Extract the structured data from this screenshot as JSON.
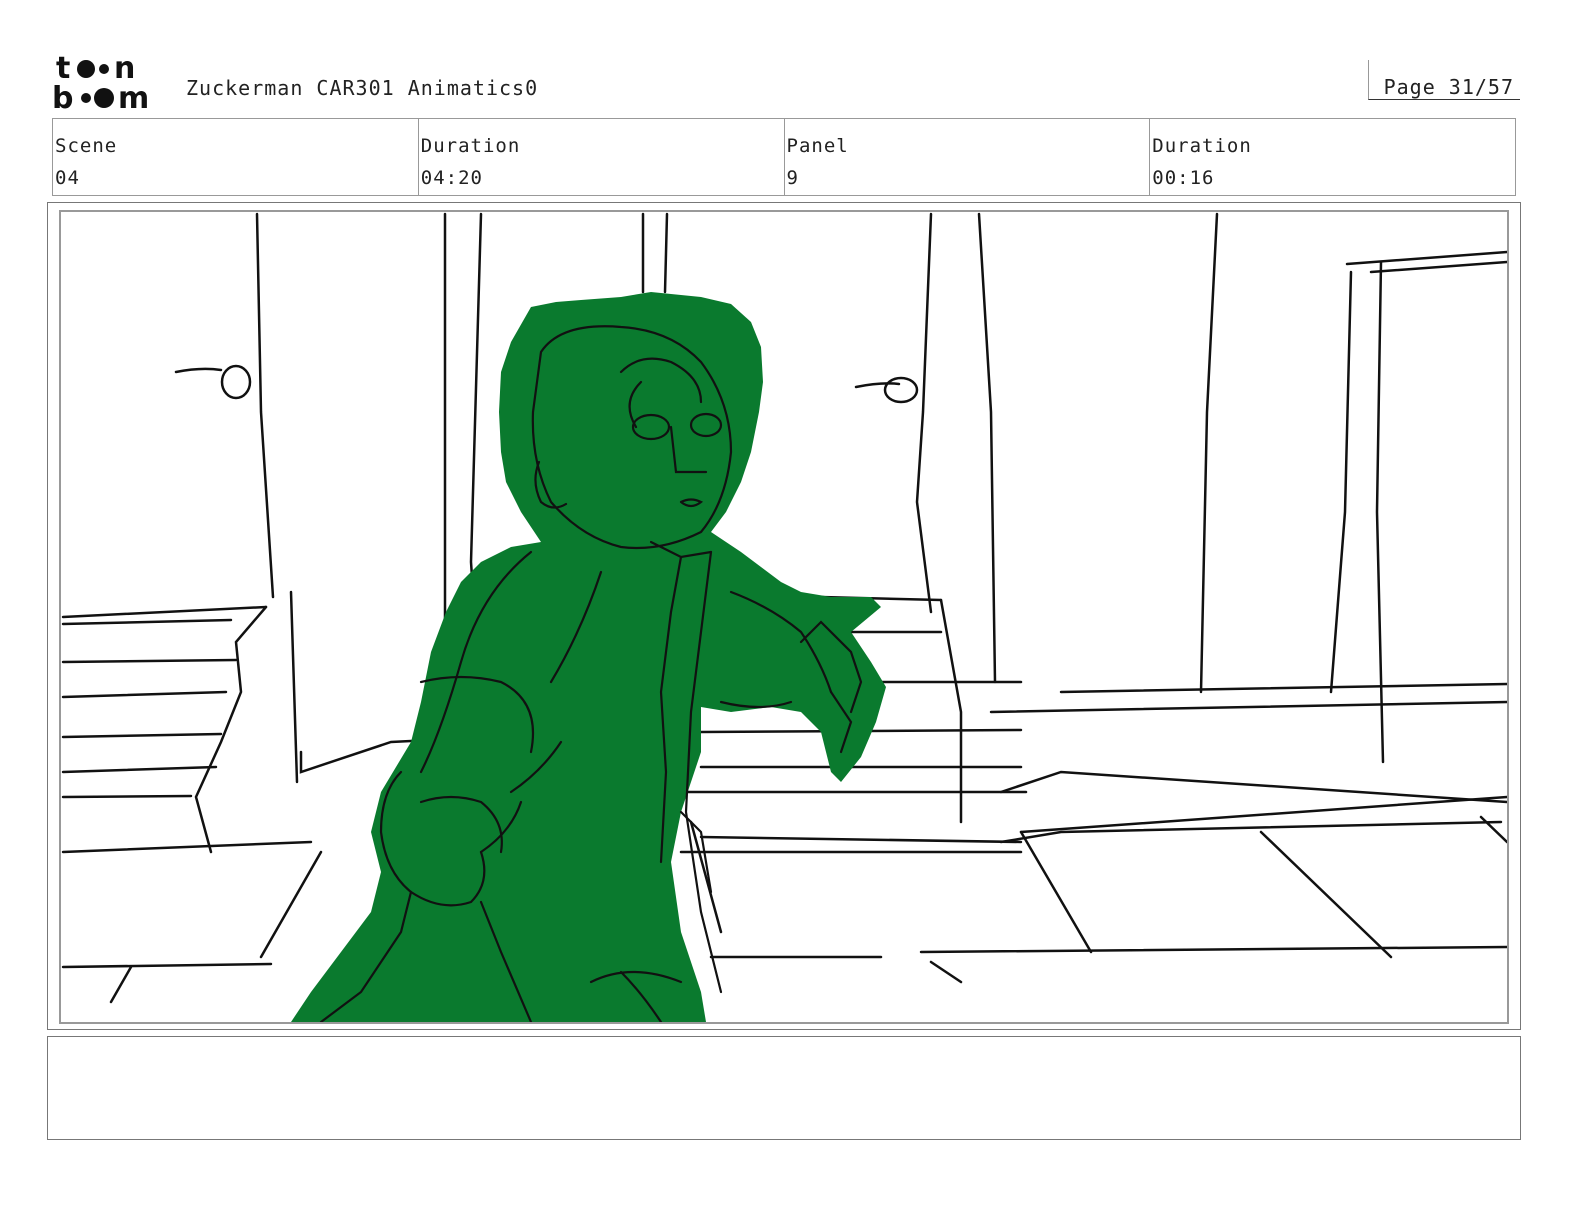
{
  "header": {
    "logo_text": "toonboom",
    "title": "Zuckerman CAR301 Animatics0",
    "page": "Page 31/57"
  },
  "info": {
    "scene_label": "Scene",
    "scene_value": "04",
    "scene_duration_label": "Duration",
    "scene_duration_value": "04:20",
    "panel_label": "Panel",
    "panel_value": "9",
    "panel_duration_label": "Duration",
    "panel_duration_value": "00:16"
  },
  "colors": {
    "character_fill": "#0a7a2e",
    "line": "#111111"
  },
  "notes": {
    "text": ""
  }
}
